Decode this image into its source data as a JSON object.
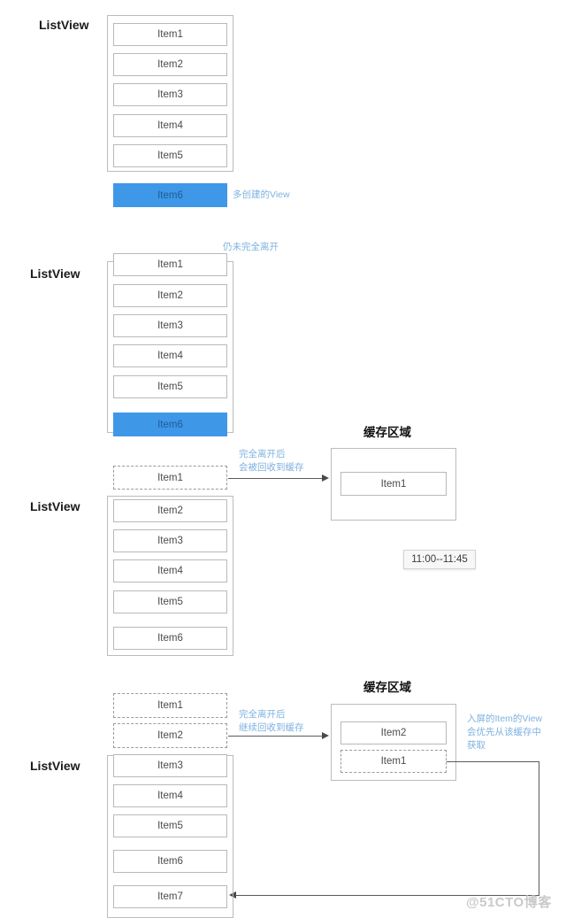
{
  "diagram": {
    "title_watermark": "@51CTO博客",
    "labels": {
      "listview": "ListView",
      "cache_area": "缓存区域"
    },
    "colors": {
      "highlight_blue": "#3f97e8",
      "note_blue": "#7fb2e0",
      "border_gray": "#b9b9b9",
      "frame_gray": "#bcbcbc",
      "arrow_gray": "#4a4a4a"
    },
    "sections": [
      {
        "id": "stage-1",
        "listview_label": "ListView",
        "visible_items": [
          "Item1",
          "Item2",
          "Item3",
          "Item4",
          "Item5"
        ],
        "extra_item": "Item6",
        "extra_item_style": "blue",
        "note": "多创建的View"
      },
      {
        "id": "stage-2",
        "listview_label": "ListView",
        "top_note": "仍未完全离开",
        "visible_items": [
          "Item1",
          "Item2",
          "Item3",
          "Item4",
          "Item5"
        ],
        "extra_item": "Item6",
        "extra_item_style": "blue"
      },
      {
        "id": "stage-3",
        "listview_label": "ListView",
        "recycled_items": [
          "Item1"
        ],
        "visible_items": [
          "Item2",
          "Item3",
          "Item4",
          "Item5",
          "Item6"
        ],
        "arrow_note": "完全离开后\n会被回收到缓存",
        "cache_title": "缓存区域",
        "cache_items": [
          "Item1"
        ],
        "tooltip": "11:00--11:45"
      },
      {
        "id": "stage-4",
        "listview_label": "ListView",
        "recycled_items": [
          "Item1",
          "Item2"
        ],
        "visible_items": [
          "Item3",
          "Item4",
          "Item5",
          "Item6",
          "Item7"
        ],
        "arrow_note": "完全离开后\n继续回收到缓存",
        "cache_title": "缓存区域",
        "cache_items": [
          "Item2",
          "Item1"
        ],
        "cache_item_styles": [
          "solid",
          "dashed"
        ],
        "reuse_note": "入屏的Item的View\n会优先从该缓存中\n获取"
      }
    ]
  }
}
